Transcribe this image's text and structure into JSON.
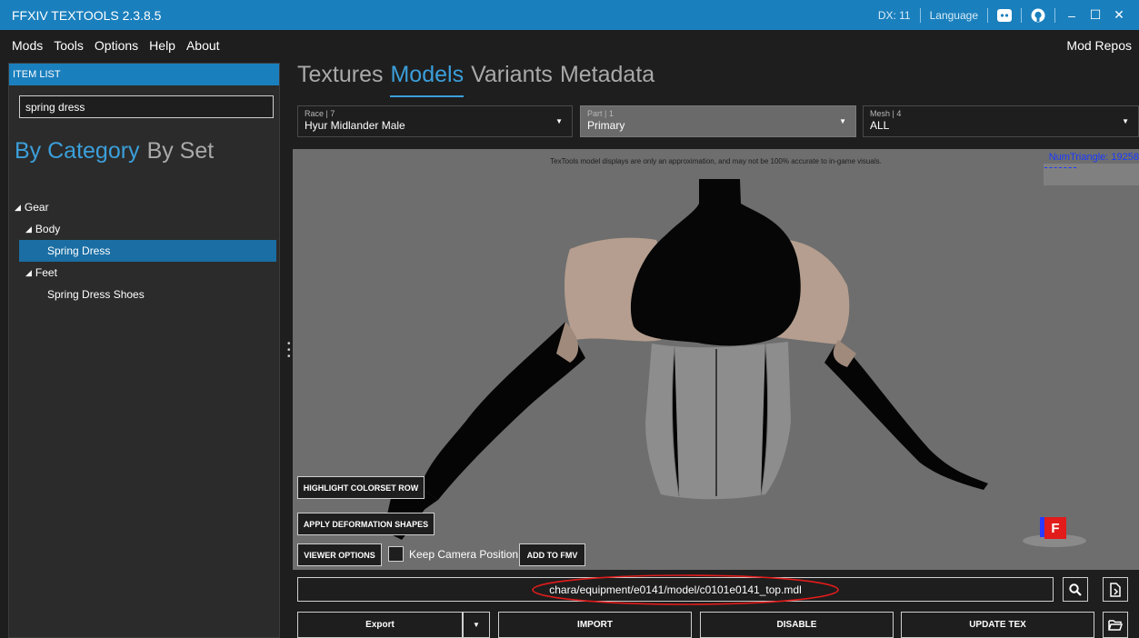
{
  "window": {
    "title": "FFXIV TEXTOOLS 2.3.8.5",
    "dx_label": "DX: 11",
    "language_label": "Language",
    "minimize": "‒",
    "maximize": "☐",
    "close": "✕"
  },
  "menu": {
    "items": [
      "Mods",
      "Tools",
      "Options",
      "Help",
      "About"
    ],
    "mod_repos": "Mod Repos"
  },
  "sidebar": {
    "header": "ITEM LIST",
    "search_value": "spring dress",
    "tab_by_category": "By Category",
    "tab_by_set": "By Set",
    "tree": [
      {
        "label": "Gear",
        "arrow": "◢"
      },
      {
        "label": "Body",
        "arrow": "◢"
      },
      {
        "label": "Spring Dress"
      },
      {
        "label": "Feet",
        "arrow": "◢"
      },
      {
        "label": "Spring Dress Shoes"
      }
    ]
  },
  "main_tabs": [
    "Textures",
    "Models",
    "Variants",
    "Metadata"
  ],
  "selectors": {
    "race": {
      "label": "Race | 7",
      "value": "Hyur Midlander Male"
    },
    "part": {
      "label": "Part | 1",
      "value": "Primary"
    },
    "mesh": {
      "label": "Mesh | 4",
      "value": "ALL"
    }
  },
  "viewport": {
    "disclaimer": "TexTools model displays are only an approximation, and may not be 100% accurate to in-game visuals.",
    "num_triangle": "NumTriangle: 19258",
    "axis_label": "F",
    "highlight_colorset_row": "HIGHLIGHT COLORSET ROW",
    "apply_deformation_shapes": "APPLY DEFORMATION SHAPES",
    "viewer_options": "VIEWER OPTIONS",
    "keep_camera_position": "Keep Camera Position",
    "add_to_fmv": "ADD TO FMV"
  },
  "path": "chara/equipment/e0141/model/c0101e0141_top.mdl",
  "bottom": {
    "export": "Export",
    "import": "IMPORT",
    "disable": "DISABLE",
    "update_tex": "UPDATE TEX"
  },
  "colors": {
    "accent": "#1a7fbd",
    "tab_active": "#3b9fda",
    "background": "#1e1e1e",
    "viewport": "#6e6e6e",
    "annotation_circle": "#e21b1b"
  }
}
